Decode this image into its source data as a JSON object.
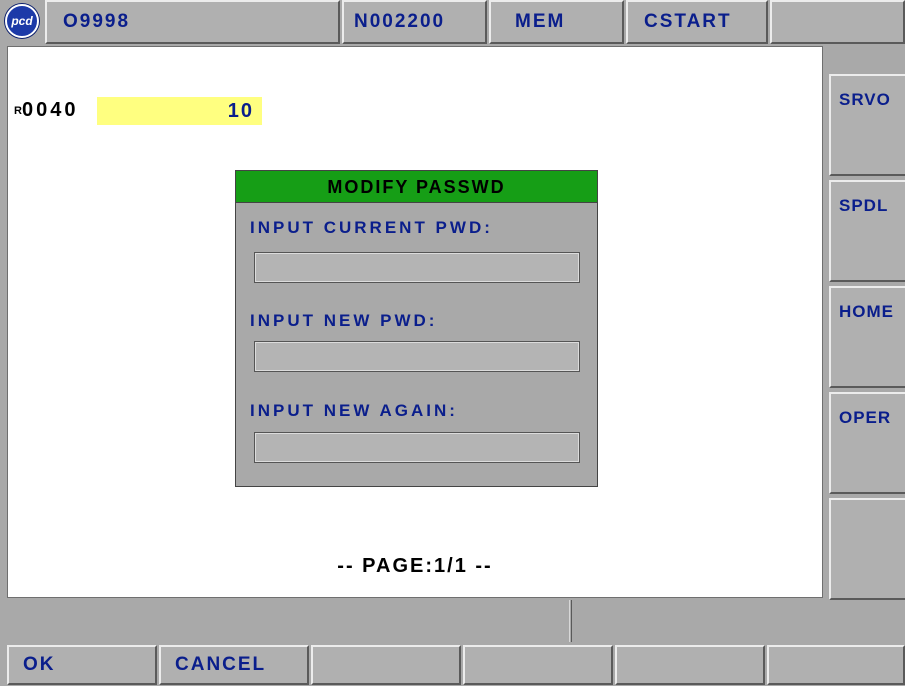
{
  "header": {
    "logo_text": "pcd",
    "program_number": "O9998",
    "sequence_number": "N002200",
    "mode": "MEM",
    "status": "CSTART"
  },
  "register": {
    "prefix": "R",
    "address": "0040",
    "value": "10"
  },
  "dialog": {
    "title": "MODIFY PASSWD",
    "fields": [
      {
        "label": "INPUT CURRENT PWD:",
        "value": ""
      },
      {
        "label": "INPUT NEW PWD:",
        "value": ""
      },
      {
        "label": "INPUT NEW AGAIN:",
        "value": ""
      }
    ]
  },
  "page_indicator": "-- PAGE:1/1 --",
  "side_buttons": [
    "SRVO",
    "SPDL",
    "HOME",
    "OPER",
    ""
  ],
  "softkeys": [
    "OK",
    "CANCEL",
    "",
    "",
    "",
    ""
  ],
  "colors": {
    "panel_gray": "#a9a9a9",
    "label_blue": "#0a1e8c",
    "dialog_title_green": "#169e16",
    "highlight_yellow": "#ffff80"
  }
}
